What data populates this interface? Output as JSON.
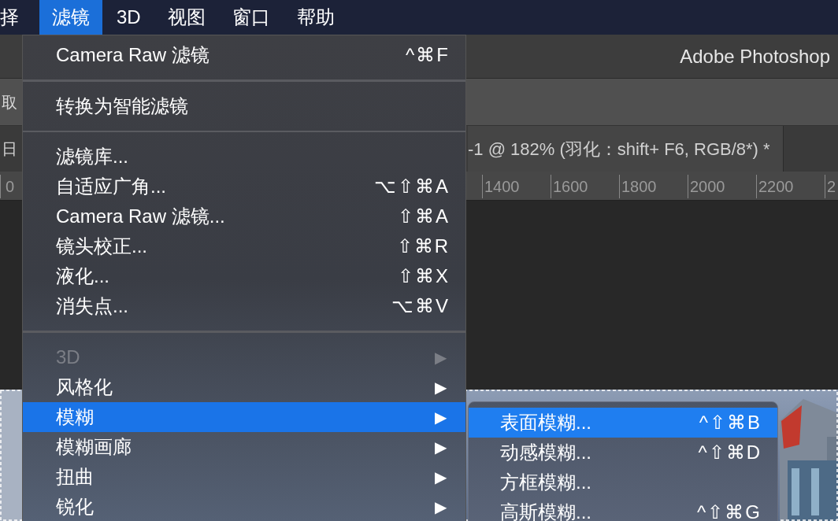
{
  "menu_bar": [
    {
      "label": "择",
      "selected": false
    },
    {
      "label": "滤镜",
      "selected": true
    },
    {
      "label": "3D",
      "selected": false
    },
    {
      "label": "视图",
      "selected": false
    },
    {
      "label": "窗口",
      "selected": false
    },
    {
      "label": "帮助",
      "selected": false
    }
  ],
  "app_title": "Adobe Photoshop",
  "options_bar": {
    "label": "取"
  },
  "document_tabs": {
    "left_label": "日",
    "tab_title": "-1 @ 182% (羽化：shift+ F6, RGB/8*) *"
  },
  "ruler": {
    "left_mark": "0",
    "marks": [
      "1400",
      "1600",
      "1800",
      "2000",
      "2200",
      "2"
    ]
  },
  "filter_menu": [
    {
      "kind": "command",
      "label": "Camera Raw 滤镜",
      "shortcut": "^⌘F",
      "disabled": false,
      "selected": false
    },
    {
      "kind": "separator"
    },
    {
      "kind": "command",
      "label": "转换为智能滤镜",
      "disabled": false,
      "selected": false
    },
    {
      "kind": "separator"
    },
    {
      "kind": "command",
      "label": "滤镜库...",
      "disabled": false,
      "selected": false
    },
    {
      "kind": "command",
      "label": "自适应广角...",
      "shortcut": "⌥⇧⌘A",
      "disabled": false,
      "selected": false
    },
    {
      "kind": "command",
      "label": "Camera Raw 滤镜...",
      "shortcut": "⇧⌘A",
      "disabled": false,
      "selected": false
    },
    {
      "kind": "command",
      "label": "镜头校正...",
      "shortcut": "⇧⌘R",
      "disabled": false,
      "selected": false
    },
    {
      "kind": "command",
      "label": "液化...",
      "shortcut": "⇧⌘X",
      "disabled": false,
      "selected": false
    },
    {
      "kind": "command",
      "label": "消失点...",
      "shortcut": "⌥⌘V",
      "disabled": false,
      "selected": false
    },
    {
      "kind": "separator"
    },
    {
      "kind": "submenu",
      "label": "3D",
      "arrow": "▶",
      "disabled": true,
      "selected": false
    },
    {
      "kind": "submenu",
      "label": "风格化",
      "arrow": "▶",
      "disabled": false,
      "selected": false
    },
    {
      "kind": "submenu",
      "label": "模糊",
      "arrow": "▶",
      "disabled": false,
      "selected": true
    },
    {
      "kind": "submenu",
      "label": "模糊画廊",
      "arrow": "▶",
      "disabled": false,
      "selected": false
    },
    {
      "kind": "submenu",
      "label": "扭曲",
      "arrow": "▶",
      "disabled": false,
      "selected": false
    },
    {
      "kind": "submenu",
      "label": "锐化",
      "arrow": "▶",
      "disabled": false,
      "selected": false
    }
  ],
  "blur_submenu": [
    {
      "label": "表面模糊...",
      "shortcut": "^⇧⌘B",
      "selected": true
    },
    {
      "label": "动感模糊...",
      "shortcut": "^⇧⌘D",
      "selected": false
    },
    {
      "label": "方框模糊...",
      "selected": false
    },
    {
      "label": "高斯模糊...",
      "shortcut": "^⇧⌘G",
      "selected": false
    }
  ]
}
